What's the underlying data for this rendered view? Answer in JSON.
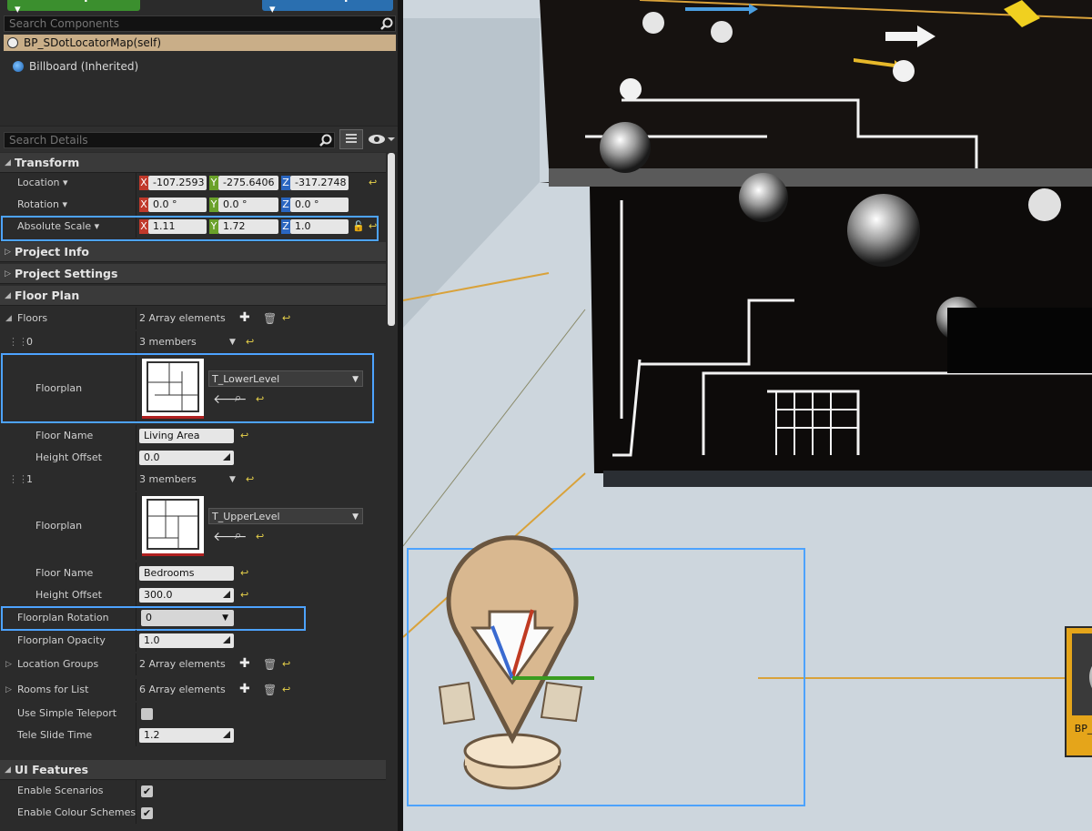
{
  "toolbar": {
    "add_component": "+Add Component ▾",
    "edit_blueprint": "⚙ Edit Blueprint ▾"
  },
  "components": {
    "search_placeholder": "Search Components",
    "self_label": "BP_SDotLocatorMap(self)",
    "billboard_label": "Billboard (Inherited)"
  },
  "details": {
    "search_placeholder": "Search Details"
  },
  "transform": {
    "title": "Transform",
    "location": {
      "label": "Location ▾",
      "x": "-107.2593",
      "y": "-275.6406",
      "z": "-317.2748"
    },
    "rotation": {
      "label": "Rotation ▾",
      "x": "0.0 °",
      "y": "0.0 °",
      "z": "0.0 °"
    },
    "scale": {
      "label": "Absolute Scale ▾",
      "x": "1.11",
      "y": "1.72",
      "z": "1.0"
    },
    "axis": {
      "x": "X",
      "y": "Y",
      "z": "Z"
    }
  },
  "categories": {
    "project_info": "Project Info",
    "project_settings": "Project Settings",
    "floor_plan": "Floor Plan",
    "ui_features": "UI Features"
  },
  "floor_plan": {
    "floors_label": "Floors",
    "floors_value": "2 Array elements",
    "floor0": {
      "index": "0",
      "members": "3 members",
      "floorplan_label": "Floorplan",
      "texture": "T_LowerLevel",
      "name_label": "Floor Name",
      "name": "Living Area",
      "height_label": "Height Offset",
      "height": "0.0"
    },
    "floor1": {
      "index": "1",
      "members": "3 members",
      "floorplan_label": "Floorplan",
      "texture": "T_UpperLevel",
      "name_label": "Floor Name",
      "name": "Bedrooms",
      "height_label": "Height Offset",
      "height": "300.0"
    },
    "rotation_label": "Floorplan Rotation",
    "rotation": "0",
    "opacity_label": "Floorplan Opacity",
    "opacity": "1.0",
    "location_groups_label": "Location Groups",
    "location_groups": "2 Array elements",
    "rooms_label": "Rooms for List",
    "rooms": "6 Array elements",
    "simple_teleport_label": "Use Simple Teleport",
    "tele_slide_label": "Tele Slide Time",
    "tele_slide": "1.2"
  },
  "ui_features": {
    "scenarios_label": "Enable Scenarios",
    "colour_schemes_label": "Enable Colour Schemes"
  },
  "viewport": {
    "info_map_label": "BP_SDotUITools InfoMap"
  },
  "colors": {
    "panel": "#2b2b2b",
    "selection": "#4da3ff",
    "self_highlight": "#c9ae88",
    "infomap": "#e5a51a"
  }
}
